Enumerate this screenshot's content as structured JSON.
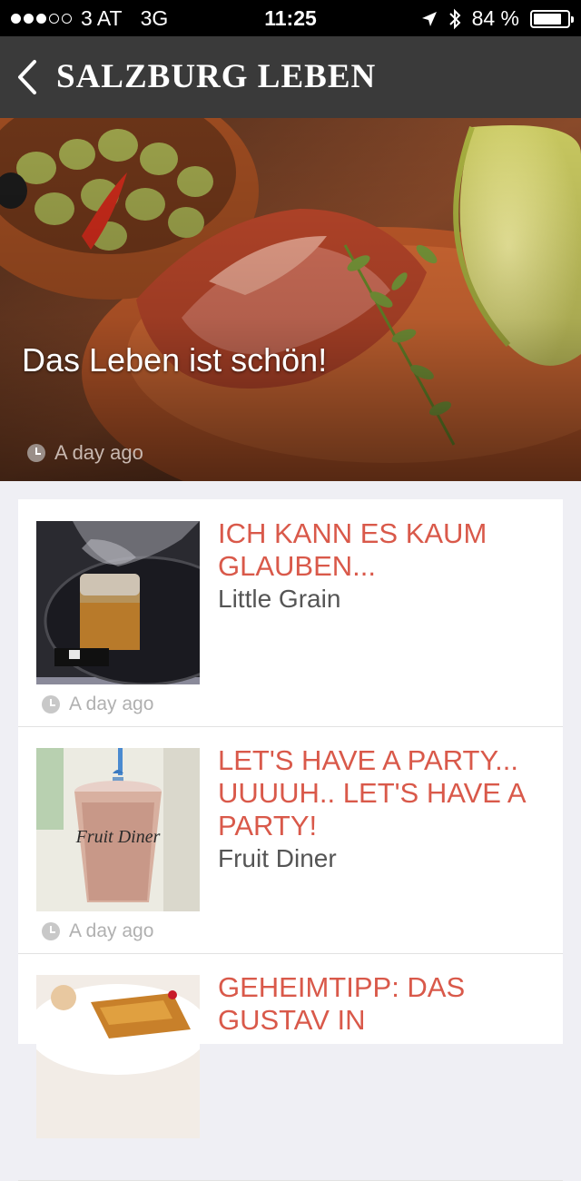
{
  "status_bar": {
    "carrier": "3 AT",
    "network": "3G",
    "time": "11:25",
    "battery": "84 %",
    "battery_level": 0.84,
    "signal_bars_filled": 3,
    "signal_bars_total": 5,
    "icons": [
      "location-arrow-icon",
      "bluetooth-icon",
      "battery-icon"
    ]
  },
  "nav": {
    "title": "SALZBURG LEBEN",
    "back_icon": "chevron-left-icon"
  },
  "hero": {
    "title": "Das Leben ist schön!",
    "time": "A day ago",
    "time_icon": "clock-icon"
  },
  "articles": [
    {
      "title": "ICH KANN ES KAUM GLAUBEN...",
      "subtitle": "Little Grain",
      "time": "A day ago"
    },
    {
      "title": "LET'S HAVE A PARTY... UUUUH.. LET'S HAVE A PARTY!",
      "subtitle": "Fruit Diner",
      "time": "A day ago"
    },
    {
      "title": "GEHEIMTIPP: DAS GUSTAV IN",
      "subtitle": "",
      "time": ""
    }
  ],
  "thumb_text": {
    "cup_logo": "Fruit Diner"
  },
  "colors": {
    "accent": "#d9594a",
    "nav_bg": "#3a3a3a",
    "page_bg": "#efeff4"
  }
}
